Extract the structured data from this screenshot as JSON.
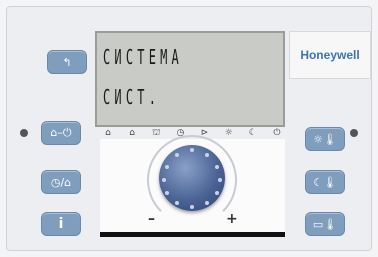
{
  "lcd": {
    "line1": "СИСТЕМА",
    "line2": "СИСТ."
  },
  "brand": {
    "logo": "Honeywell"
  },
  "buttons_left": [
    {
      "name": "back-button",
      "glyph": "↰"
    },
    {
      "name": "home-occupancy-button",
      "glyph": "⌂–⏻"
    },
    {
      "name": "clock-mode-button",
      "glyph": "◷/⌂"
    },
    {
      "name": "info-button",
      "glyph": "i"
    }
  ],
  "buttons_right": [
    {
      "name": "day-temperature-button",
      "glyph": "☼🌡"
    },
    {
      "name": "night-temperature-button",
      "glyph": "☾🌡"
    },
    {
      "name": "holiday-temperature-button",
      "glyph": "▭🌡"
    }
  ],
  "mode_icons": [
    "⌂",
    "⌂",
    "⛫",
    "◷",
    "⊳",
    "☼",
    "☾",
    "⏻"
  ],
  "dial": {
    "minus": "–",
    "plus": "+"
  }
}
